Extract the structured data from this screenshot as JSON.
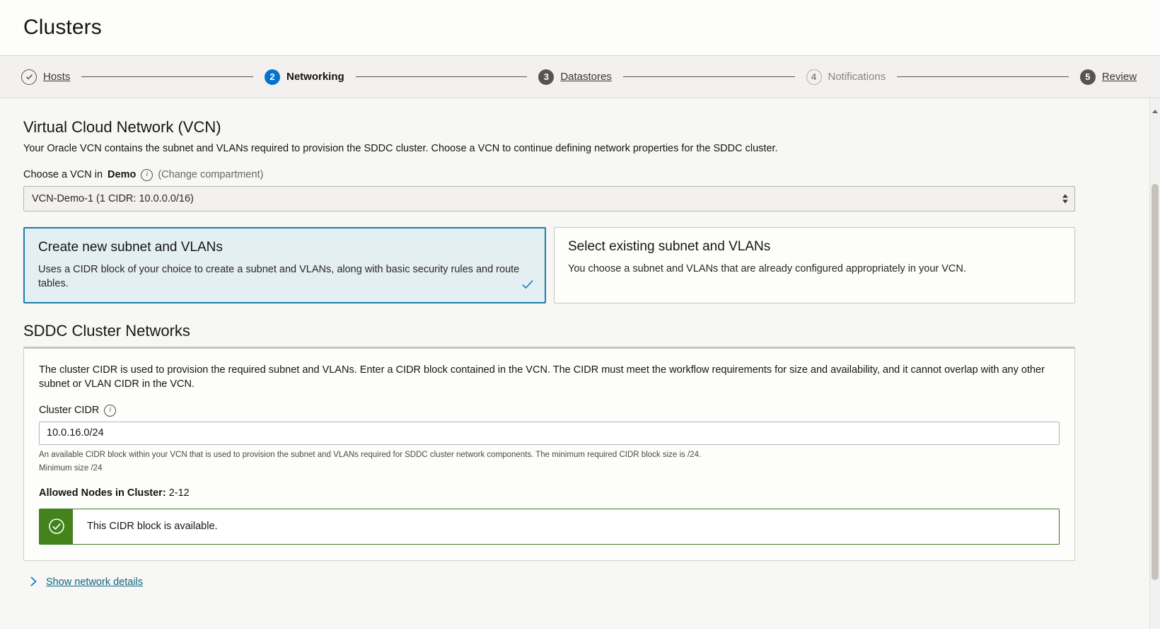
{
  "header": {
    "title": "Clusters"
  },
  "stepper": {
    "steps": [
      {
        "number": "1",
        "label": "Hosts",
        "state": "done",
        "badge_glyph": "check"
      },
      {
        "number": "2",
        "label": "Networking",
        "state": "current",
        "badge_glyph": "2"
      },
      {
        "number": "3",
        "label": "Datastores",
        "state": "visited",
        "badge_glyph": "3"
      },
      {
        "number": "4",
        "label": "Notifications",
        "state": "pending",
        "badge_glyph": "4"
      },
      {
        "number": "5",
        "label": "Review",
        "state": "visited",
        "badge_glyph": "5"
      }
    ]
  },
  "vcn": {
    "section_title": "Virtual Cloud Network (VCN)",
    "section_desc": "Your Oracle VCN contains the subnet and VLANs required to provision the SDDC cluster. Choose a VCN to continue defining network properties for the SDDC cluster.",
    "choose_label_prefix": "Choose a VCN in",
    "compartment": "Demo",
    "info_icon": "info-icon",
    "change_compartment": "(Change compartment)",
    "selected_vcn": "VCN-Demo-1 (1 CIDR: 10.0.0.0/16)"
  },
  "cards": [
    {
      "title": "Create new subnet and VLANs",
      "desc": "Uses a CIDR block of your choice to create a subnet and VLANs, along with basic security rules and route tables.",
      "selected": true
    },
    {
      "title": "Select existing subnet and VLANs",
      "desc": "You choose a subnet and VLANs that are already configured appropriately in your VCN.",
      "selected": false
    }
  ],
  "sddc": {
    "heading": "SDDC Cluster Networks",
    "desc": "The cluster CIDR is used to provision the required subnet and VLANs. Enter a CIDR block contained in the VCN. The CIDR must meet the workflow requirements for size and availability, and it cannot overlap with any other subnet or VLAN CIDR in the VCN.",
    "cidr_label": "Cluster CIDR",
    "cidr_value": "10.0.16.0/24",
    "cidr_placeholder": "10.0.16.0/24",
    "help_text": "An available CIDR block within your VCN that is used to provision the subnet and VLANs required for SDDC cluster network components. The minimum required CIDR block size is /24.",
    "min_size_text": "Minimum size /24",
    "allowed_nodes_label": "Allowed Nodes in Cluster:",
    "allowed_nodes_value": "2-12",
    "alert": {
      "icon": "check-circle-icon",
      "message": "This CIDR block is available.",
      "color": "#44821b"
    }
  },
  "footer": {
    "show_details_label": "Show network details",
    "chevron_icon": "chevron-right-icon"
  },
  "colors": {
    "accent_blue": "#0572ce",
    "link_teal": "#10667f",
    "card_selected_border": "#1d7ca8",
    "card_selected_bg": "#e4eff4",
    "success_green": "#44821b",
    "page_bg": "#f7f7f5"
  }
}
